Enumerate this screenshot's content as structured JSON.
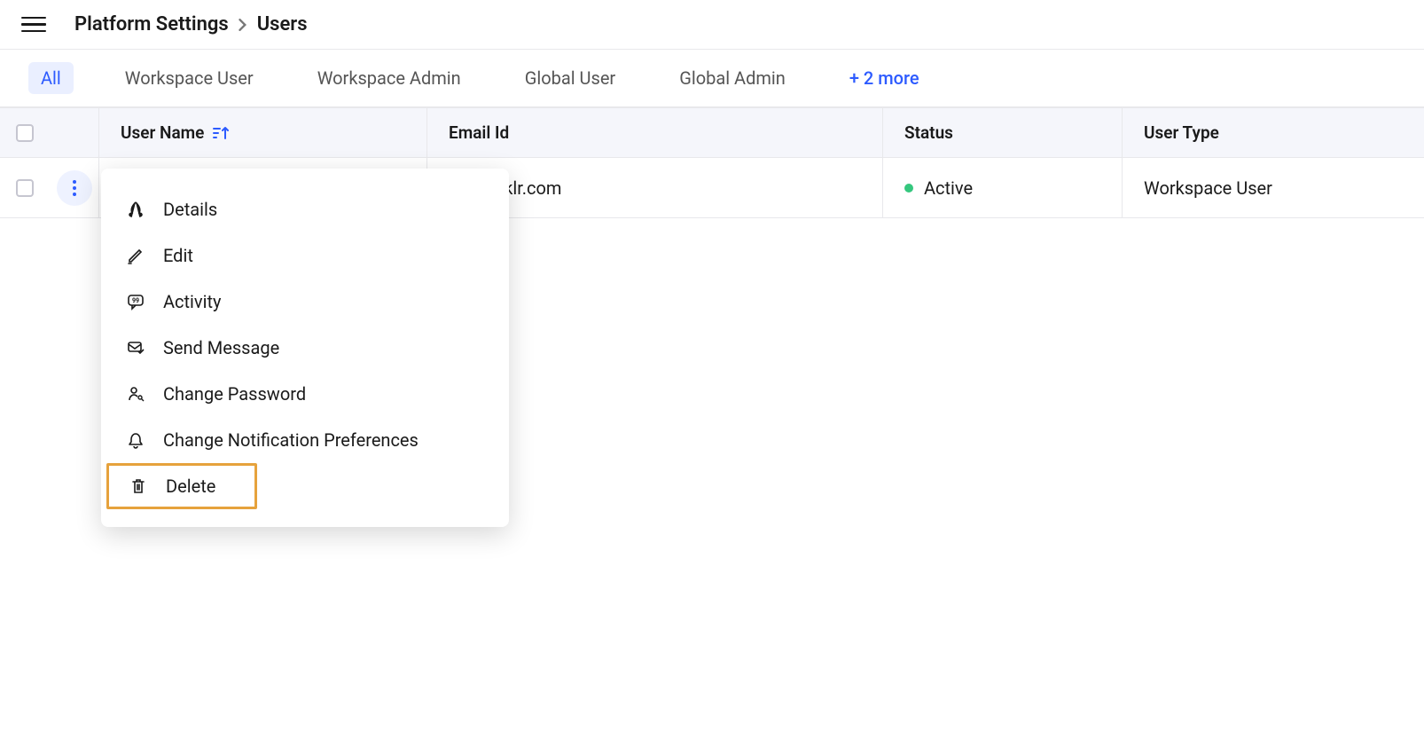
{
  "breadcrumb": {
    "parent": "Platform Settings",
    "current": "Users"
  },
  "tabs": {
    "items": [
      "All",
      "Workspace User",
      "Workspace Admin",
      "Global User",
      "Global Admin"
    ],
    "more": "+ 2 more",
    "activeIndex": 0
  },
  "columns": {
    "name": "User Name",
    "email": "Email Id",
    "status": "Status",
    "type": "User Type"
  },
  "row": {
    "email": "@sprinklr.com",
    "status": "Active",
    "type": "Workspace User"
  },
  "menu": {
    "details": "Details",
    "edit": "Edit",
    "activity": "Activity",
    "sendMessage": "Send Message",
    "changePassword": "Change Password",
    "changeNotif": "Change Notification Preferences",
    "delete": "Delete"
  }
}
